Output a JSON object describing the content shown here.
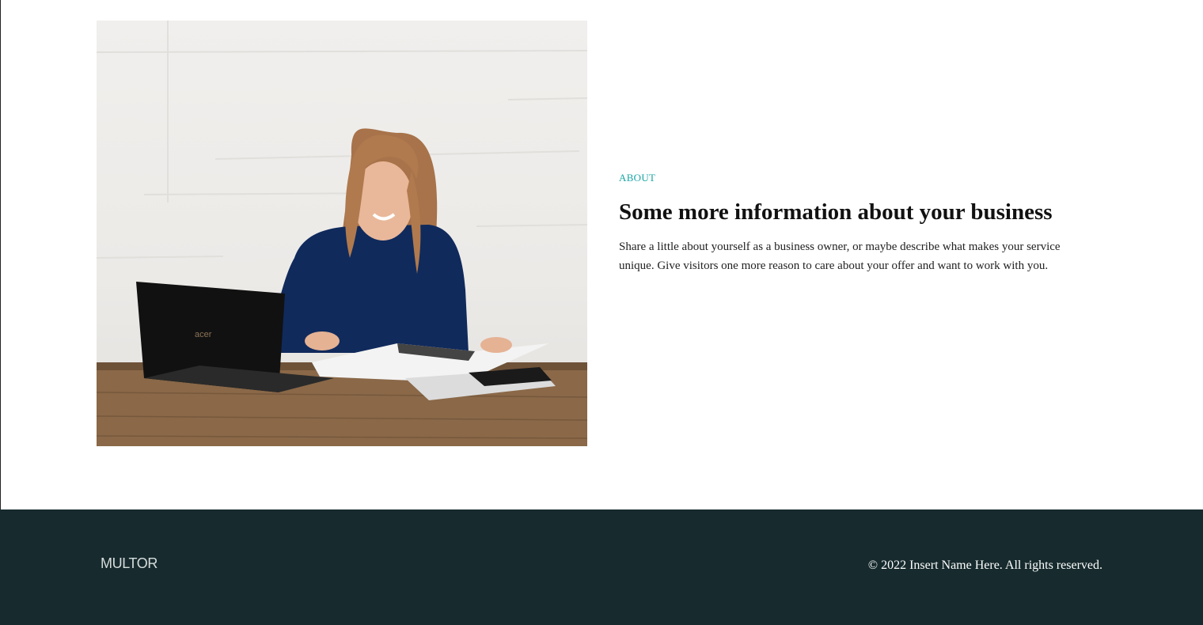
{
  "about": {
    "eyebrow": "ABOUT",
    "title": "Some more information about your business",
    "body": "Share a little about yourself as a business owner, or maybe describe what makes your service unique. Give visitors one more reason to care about your offer and want to work with you.",
    "photo_laptop_brand": "acer"
  },
  "footer": {
    "logo": "MULTOR",
    "copyright": "© 2022 Insert Name Here. All rights reserved."
  },
  "colors": {
    "accent": "#1aa5a6",
    "footer_bg": "#172b2e"
  }
}
